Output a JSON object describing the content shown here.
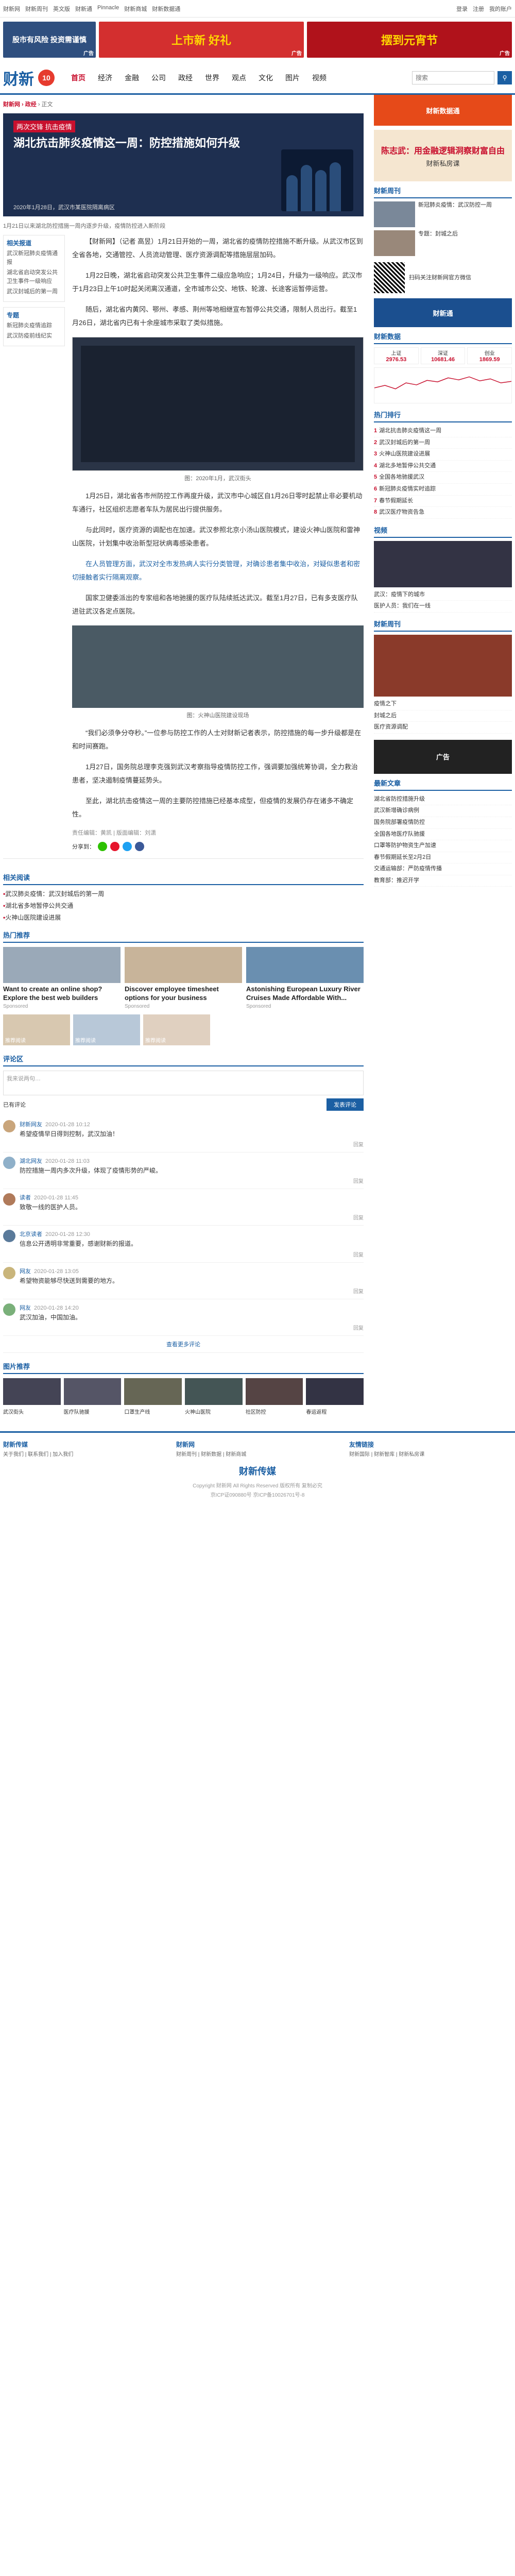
{
  "topbar": {
    "links": [
      "财新网",
      "财新周刊",
      "英文版",
      "财新通",
      "Pinnacle",
      "财新商城",
      "财新数据通"
    ],
    "right": [
      "登录",
      "注册",
      "我的账户"
    ]
  },
  "banner": {
    "ad1": "股市有风险 投资需谨慎",
    "ad2": "上市新 好礼",
    "ad3": "摆到元宵节",
    "ad_tag": "广告"
  },
  "header": {
    "logo": "财新",
    "logo_badge": "10",
    "nav": [
      "首页",
      "经济",
      "金融",
      "公司",
      "政经",
      "世界",
      "观点",
      "文化",
      "图片",
      "视频"
    ],
    "search_placeholder": "搜索"
  },
  "crumb": {
    "prefix": "财新网 › 政经",
    "suffix": " › 正文"
  },
  "hero": {
    "badge": "两次交锋 抗击疫情",
    "title": "湖北抗击肺炎疫情这一周：防控措施如何升级",
    "caption": "2020年1月28日，武汉市某医院隔离病区"
  },
  "subtitle": "1月21日以来湖北防控措施一周内逐步升级，疫情防控进入新阶段",
  "leftcol": {
    "box1_title": "相关报道",
    "box1_items": [
      "武汉新冠肺炎疫情通报",
      "湖北省启动突发公共卫生事件一级响应",
      "武汉封城后的第一周"
    ],
    "box2_title": "专题",
    "box2_items": [
      "新冠肺炎疫情追踪",
      "武汉防疫前线纪实"
    ]
  },
  "article": {
    "paragraphs": [
      "【财新网】（记者 高昱）1月21日开始的一周，湖北省的疫情防控措施不断升级。从武汉市区到全省各地，交通管控、人员流动管理、医疗资源调配等措施层层加码。",
      "1月22日晚，湖北省启动突发公共卫生事件二级应急响应；1月24日，升级为一级响应。武汉市于1月23日上午10时起关闭离汉通道，全市城市公交、地铁、轮渡、长途客运暂停运营。",
      "随后，湖北省内黄冈、鄂州、孝感、荆州等地相继宣布暂停公共交通，限制人员出行。截至1月26日，湖北省内已有十余座城市采取了类似措施。",
      "1月25日，湖北省各市州防控工作再度升级，武汉市中心城区自1月26日零时起禁止非必要机动车通行，社区组织志愿者车队为居民出行提供服务。",
      "与此同时，医疗资源的调配也在加速。武汉参照北京小汤山医院模式，建设火神山医院和雷神山医院，计划集中收治新型冠状病毒感染患者。",
      "在人员管理方面，武汉对全市发热病人实行分类管理，对确诊患者集中收治，对疑似患者和密切接触者实行隔离观察。",
      "国家卫健委派出的专家组和各地驰援的医疗队陆续抵达武汉。截至1月27日，已有多支医疗队进驻武汉各定点医院。",
      "“我们必须争分夺秒。”一位参与防控工作的人士对财新记者表示，防控措施的每一步升级都是在和时间赛跑。",
      "1月27日，国务院总理李克强到武汉考察指导疫情防控工作，强调要加强统筹协调，全力救治患者，坚决遏制疫情蔓延势头。",
      "至此，湖北抗击疫情这一周的主要防控措施已经基本成型，但疫情的发展仍存在诸多不确定性。"
    ],
    "figure_caption": "图：2020年1月，武汉街头",
    "figure2_caption": "图：火神山医院建设现场",
    "meta": "责任编辑：黄凯 | 版面编辑：刘潇",
    "share_label": "分享到："
  },
  "related": {
    "title": "相关阅读",
    "items": [
      "武汉肺炎疫情：武汉封城后的第一周",
      "湖北省多地暂停公共交通",
      "火神山医院建设进展"
    ]
  },
  "picks": {
    "title": "热门推荐",
    "cards": [
      {
        "t": "Want to create an online shop? Explore the best web builders",
        "s": "Sponsored"
      },
      {
        "t": "Discover employee timesheet options for your business",
        "s": "Sponsored"
      },
      {
        "t": "Astonishing European Luxury River Cruises Made Affordable With...",
        "s": "Sponsored"
      }
    ],
    "small": [
      "推荐阅读",
      "推荐阅读",
      "推荐阅读"
    ]
  },
  "comments": {
    "title": "评论区",
    "placeholder": "我来说两句…",
    "count_label": "已有评论",
    "submit": "发表评论",
    "items": [
      {
        "u": "财新网友",
        "time": "2020-01-28 10:12",
        "x": "希望疫情早日得到控制，武汉加油！",
        "r": "回复"
      },
      {
        "u": "湖北网友",
        "time": "2020-01-28 11:03",
        "x": "防控措施一周内多次升级，体现了疫情形势的严峻。",
        "r": "回复"
      },
      {
        "u": "读者",
        "time": "2020-01-28 11:45",
        "x": "致敬一线的医护人员。",
        "r": "回复"
      },
      {
        "u": "北京读者",
        "time": "2020-01-28 12:30",
        "x": "信息公开透明非常重要，感谢财新的报道。",
        "r": "回复"
      },
      {
        "u": "网友",
        "time": "2020-01-28 13:05",
        "x": "希望物资能够尽快送到需要的地方。",
        "r": "回复"
      },
      {
        "u": "网友",
        "time": "2020-01-28 14:20",
        "x": "武汉加油，中国加油。",
        "r": "回复"
      }
    ],
    "more": "查看更多评论"
  },
  "gallery": {
    "title": "图片推荐",
    "caps": [
      "武汉街头",
      "医疗队驰援",
      "口罩生产线",
      "火神山医院",
      "社区防控",
      "春运返程"
    ]
  },
  "side": {
    "ad1": "财新数据通",
    "promo_title": "陈志武：用金融逻辑洞察财富自由",
    "promo_sub": "财新私房课",
    "block1_title": "财新周刊",
    "block1_items": [
      {
        "tx": "新冠肺炎疫情：武汉防控一周"
      },
      {
        "tx": "专题：封城之后"
      }
    ],
    "qr_text": "扫码关注财新网官方微信",
    "ad2": "财新通",
    "market_title": "财新数据",
    "market": [
      {
        "n": "上证",
        "v": "2976.53"
      },
      {
        "n": "深证",
        "v": "10681.46"
      },
      {
        "n": "创业",
        "v": "1869.59"
      }
    ],
    "hot_title": "热门排行",
    "hot": [
      "湖北抗击肺炎疫情这一周",
      "武汉封城后的第一周",
      "火神山医院建设进展",
      "湖北多地暂停公共交通",
      "全国各地驰援武汉",
      "新冠肺炎疫情实时追踪",
      "春节假期延长",
      "武汉医疗物资告急"
    ],
    "video_title": "视频",
    "video_items": [
      "武汉：疫情下的城市",
      "医护人员：我们在一线"
    ],
    "mag_title": "财新周刊",
    "mag_items": [
      "疫情之下",
      "封城之后",
      "医疗资源调配"
    ],
    "ad3": "广告",
    "list_title": "最新文章",
    "list": [
      "湖北省防控措施升级",
      "武汉新增确诊病例",
      "国务院部署疫情防控",
      "全国各地医疗队驰援",
      "口罩等防护物资生产加速",
      "春节假期延长至2月2日",
      "交通运输部：严防疫情传播",
      "教育部：推迟开学"
    ]
  },
  "footer": {
    "cols": [
      {
        "h": "财新传媒",
        "p": "关于我们 | 联系我们 | 加入我们"
      },
      {
        "h": "财新网",
        "p": "财新周刊 | 财新数据 | 财新商城"
      },
      {
        "h": "友情链接",
        "p": "财新国际 | 财新智库 | 财新私房课"
      }
    ],
    "logo": "财新传媒",
    "copy": "Copyright 财新网 All Rights Reserved 版权所有 复制必究",
    "copy2": "京ICP证090880号 京ICP备10026701号-8"
  }
}
